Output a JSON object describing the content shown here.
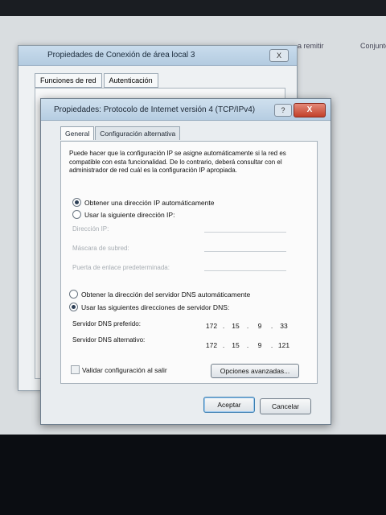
{
  "background": {
    "menu_items": [
      "a remitir",
      "Conjunto"
    ],
    "parent_window": {
      "title": "Propiedades de Conexión de área local 3",
      "close_label": "X",
      "tabs": [
        "Funciones de red",
        "Autenticación"
      ]
    }
  },
  "dialog": {
    "title": "Propiedades: Protocolo de Internet versión 4 (TCP/IPv4)",
    "help_label": "?",
    "close_label": "X",
    "tabs": [
      "General",
      "Configuración alternativa"
    ],
    "description": "Puede hacer que la configuración IP se asigne automáticamente si la red es compatible con esta funcionalidad. De lo contrario, deberá consultar con el administrador de red cuál es la configuración IP apropiada.",
    "ip_options": {
      "auto": "Obtener una dirección IP automáticamente",
      "manual": "Usar la siguiente dirección IP:",
      "selected": "auto"
    },
    "ip_fields": {
      "ip_label": "Dirección IP:",
      "mask_label": "Máscara de subred:",
      "gateway_label": "Puerta de enlace predeterminada:"
    },
    "dns_options": {
      "auto": "Obtener la dirección del servidor DNS automáticamente",
      "manual": "Usar las siguientes direcciones de servidor DNS:",
      "selected": "manual"
    },
    "dns_fields": {
      "preferred_label": "Servidor DNS preferido:",
      "preferred_value": [
        "172",
        "15",
        "9",
        "33"
      ],
      "alternate_label": "Servidor DNS alternativo:",
      "alternate_value": [
        "172",
        "15",
        "9",
        "121"
      ]
    },
    "validate_label": "Validar configuración al salir",
    "validate_checked": false,
    "advanced_button": "Opciones avanzadas...",
    "ok_button": "Aceptar",
    "cancel_button": "Cancelar"
  },
  "colors": {
    "title_gradient_top": "#cfe0ee",
    "close_red": "#c2402a",
    "screen_bg": "#d9dde0"
  }
}
